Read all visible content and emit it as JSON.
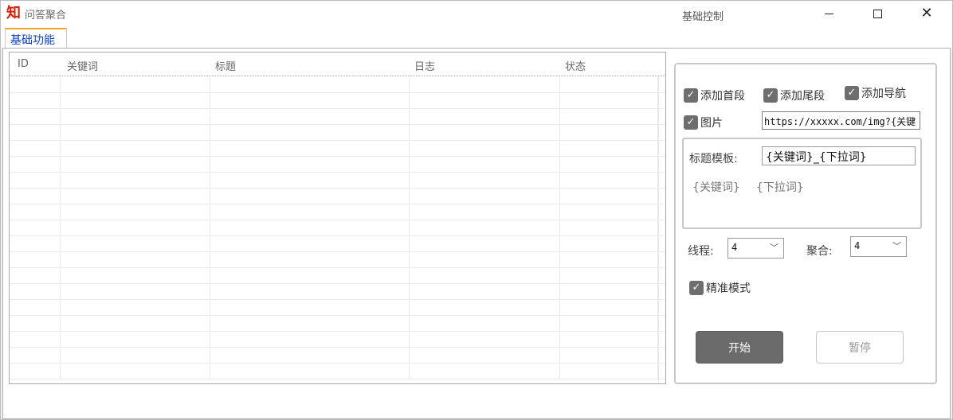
{
  "window": {
    "title": "问答聚合",
    "icon": "app-logo-icon"
  },
  "tabs": [
    {
      "label": "基础功能",
      "active": true
    }
  ],
  "grid": {
    "columns": [
      "ID",
      "关键词",
      "标题",
      "日志",
      "状态"
    ],
    "rows": []
  },
  "control": {
    "group_title": "基础控制",
    "checkboxes": {
      "add_head": {
        "label": "添加首段",
        "checked": true
      },
      "add_tail": {
        "label": "添加尾段",
        "checked": true
      },
      "add_nav": {
        "label": "添加导航",
        "checked": true
      },
      "image": {
        "label": "图片",
        "checked": true
      },
      "precise": {
        "label": "精准模式",
        "checked": true
      }
    },
    "image_url": "https://xxxxx.com/img?{关键",
    "title_template": {
      "label": "标题模板:",
      "value": "{关键词}_{下拉词}",
      "tags": [
        "{关键词}",
        "{下拉词}"
      ]
    },
    "threads": {
      "label": "线程:",
      "value": "4"
    },
    "aggregate": {
      "label": "聚合:",
      "value": "4"
    },
    "start_label": "开始",
    "pause_label": "暂停"
  },
  "colors": {
    "tab_accent": "#f5a623",
    "tab_text": "#0a3cc8",
    "start_bg": "#6b6b6b",
    "logo": "#d81e06"
  }
}
